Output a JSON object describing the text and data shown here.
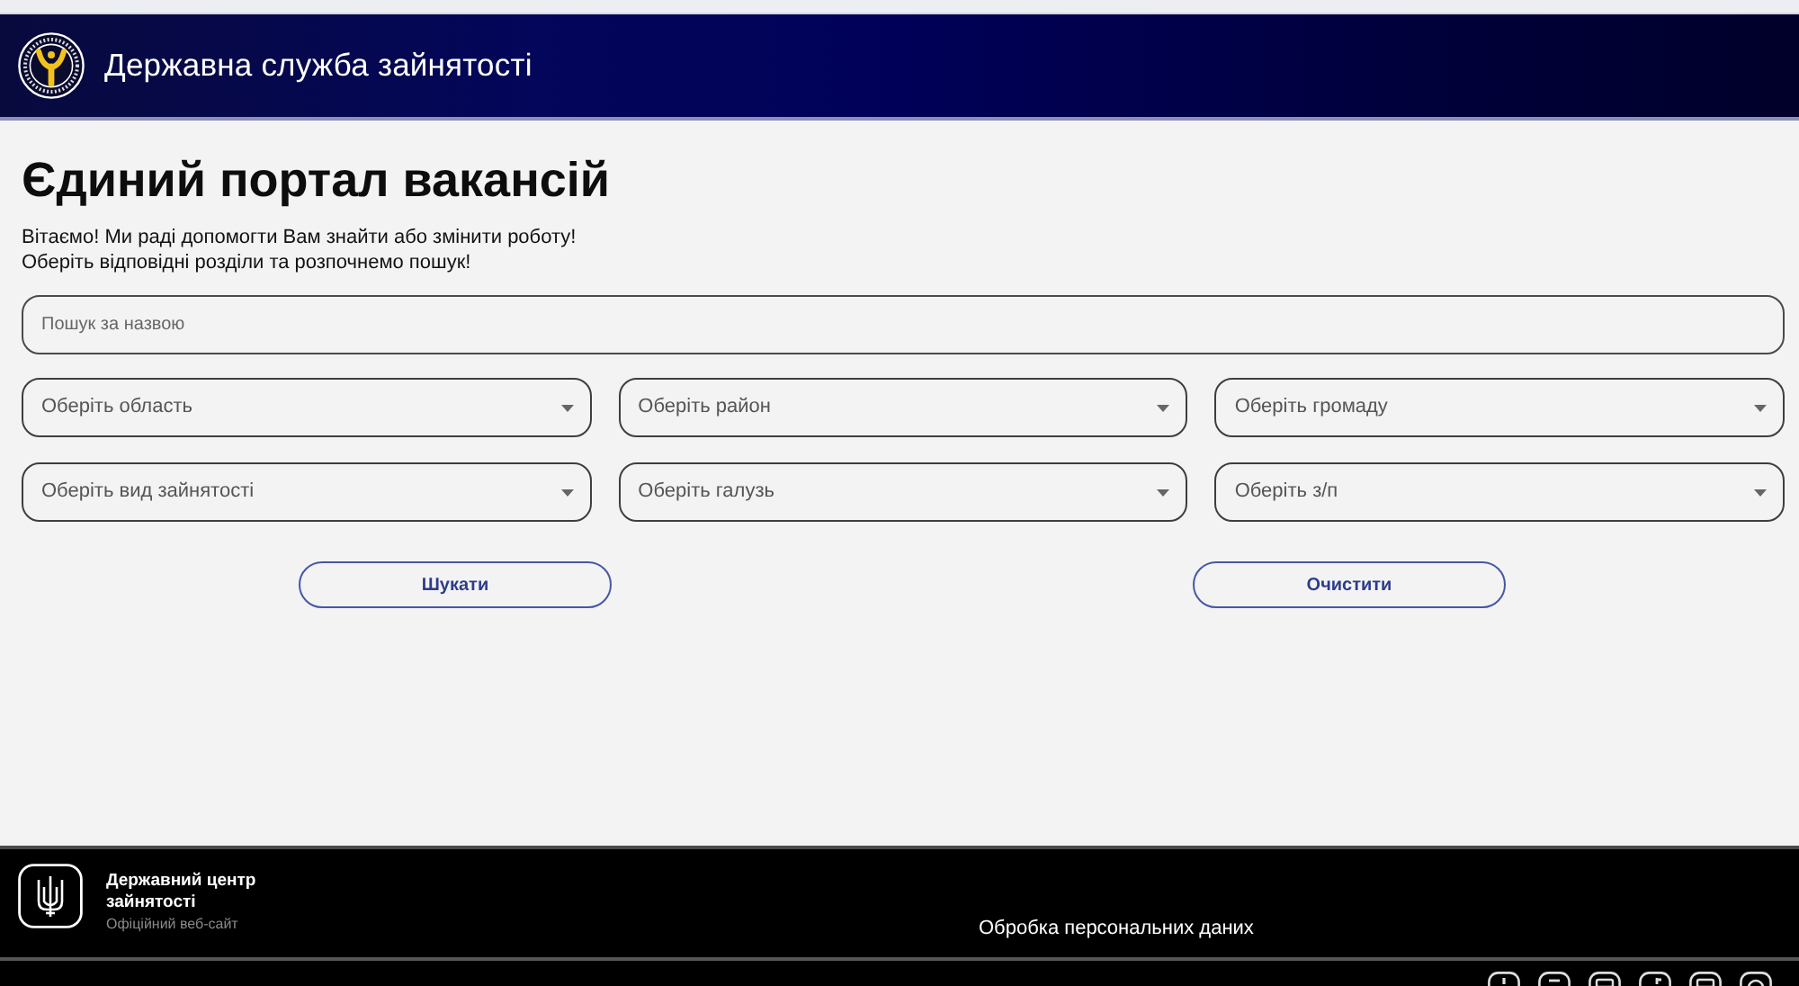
{
  "header": {
    "title": "Державна служба зайнятості"
  },
  "page": {
    "heading": "Єдиний портал вакансій",
    "intro": [
      "Вітаємо! Ми раді допомогти Вам знайти або змінити роботу!",
      "Оберіть відповідні розділи та розпочнемо пошук!"
    ]
  },
  "search": {
    "placeholder": "Пошук за назвою"
  },
  "filters": [
    {
      "placeholder": "Оберіть область"
    },
    {
      "placeholder": "Оберіть район"
    },
    {
      "placeholder": "Оберіть громаду"
    },
    {
      "placeholder": "Оберіть вид зайнятості"
    },
    {
      "placeholder": "Оберіть галузь"
    },
    {
      "placeholder": "Оберіть з/п"
    }
  ],
  "buttons": [
    {
      "label": "Шукати",
      "kind": "search"
    },
    {
      "label": "Очистити",
      "kind": "clear"
    }
  ],
  "footer": {
    "org_name": "Державний центр зайнятості",
    "subtitle": "Офіційний веб-сайт",
    "link": "Обробка персональних даних"
  }
}
